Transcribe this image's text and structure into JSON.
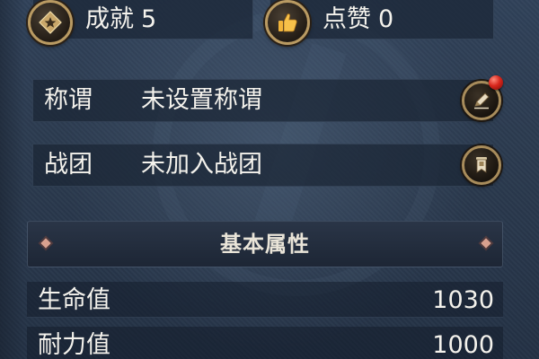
{
  "top_stats": {
    "achievement": {
      "label": "成就",
      "value": "5",
      "icon": "star-diamond-icon"
    },
    "likes": {
      "label": "点赞",
      "value": "0",
      "icon": "thumbs-up-icon"
    }
  },
  "profile": {
    "title": {
      "label": "称谓",
      "value": "未设置称谓",
      "action_icon": "pencil-edit-icon",
      "has_notification": true
    },
    "guild": {
      "label": "战团",
      "value": "未加入战团",
      "action_icon": "banner-icon"
    }
  },
  "basic_attributes": {
    "header": "基本属性",
    "rows": [
      {
        "name": "生命值",
        "value": "1030"
      },
      {
        "name": "耐力值",
        "value": "1000"
      }
    ]
  },
  "colors": {
    "background": "#2b3a4e",
    "icon_ring": "#b99a62",
    "notification": "#d8261c",
    "diamond_accent": "#d9a18f"
  }
}
